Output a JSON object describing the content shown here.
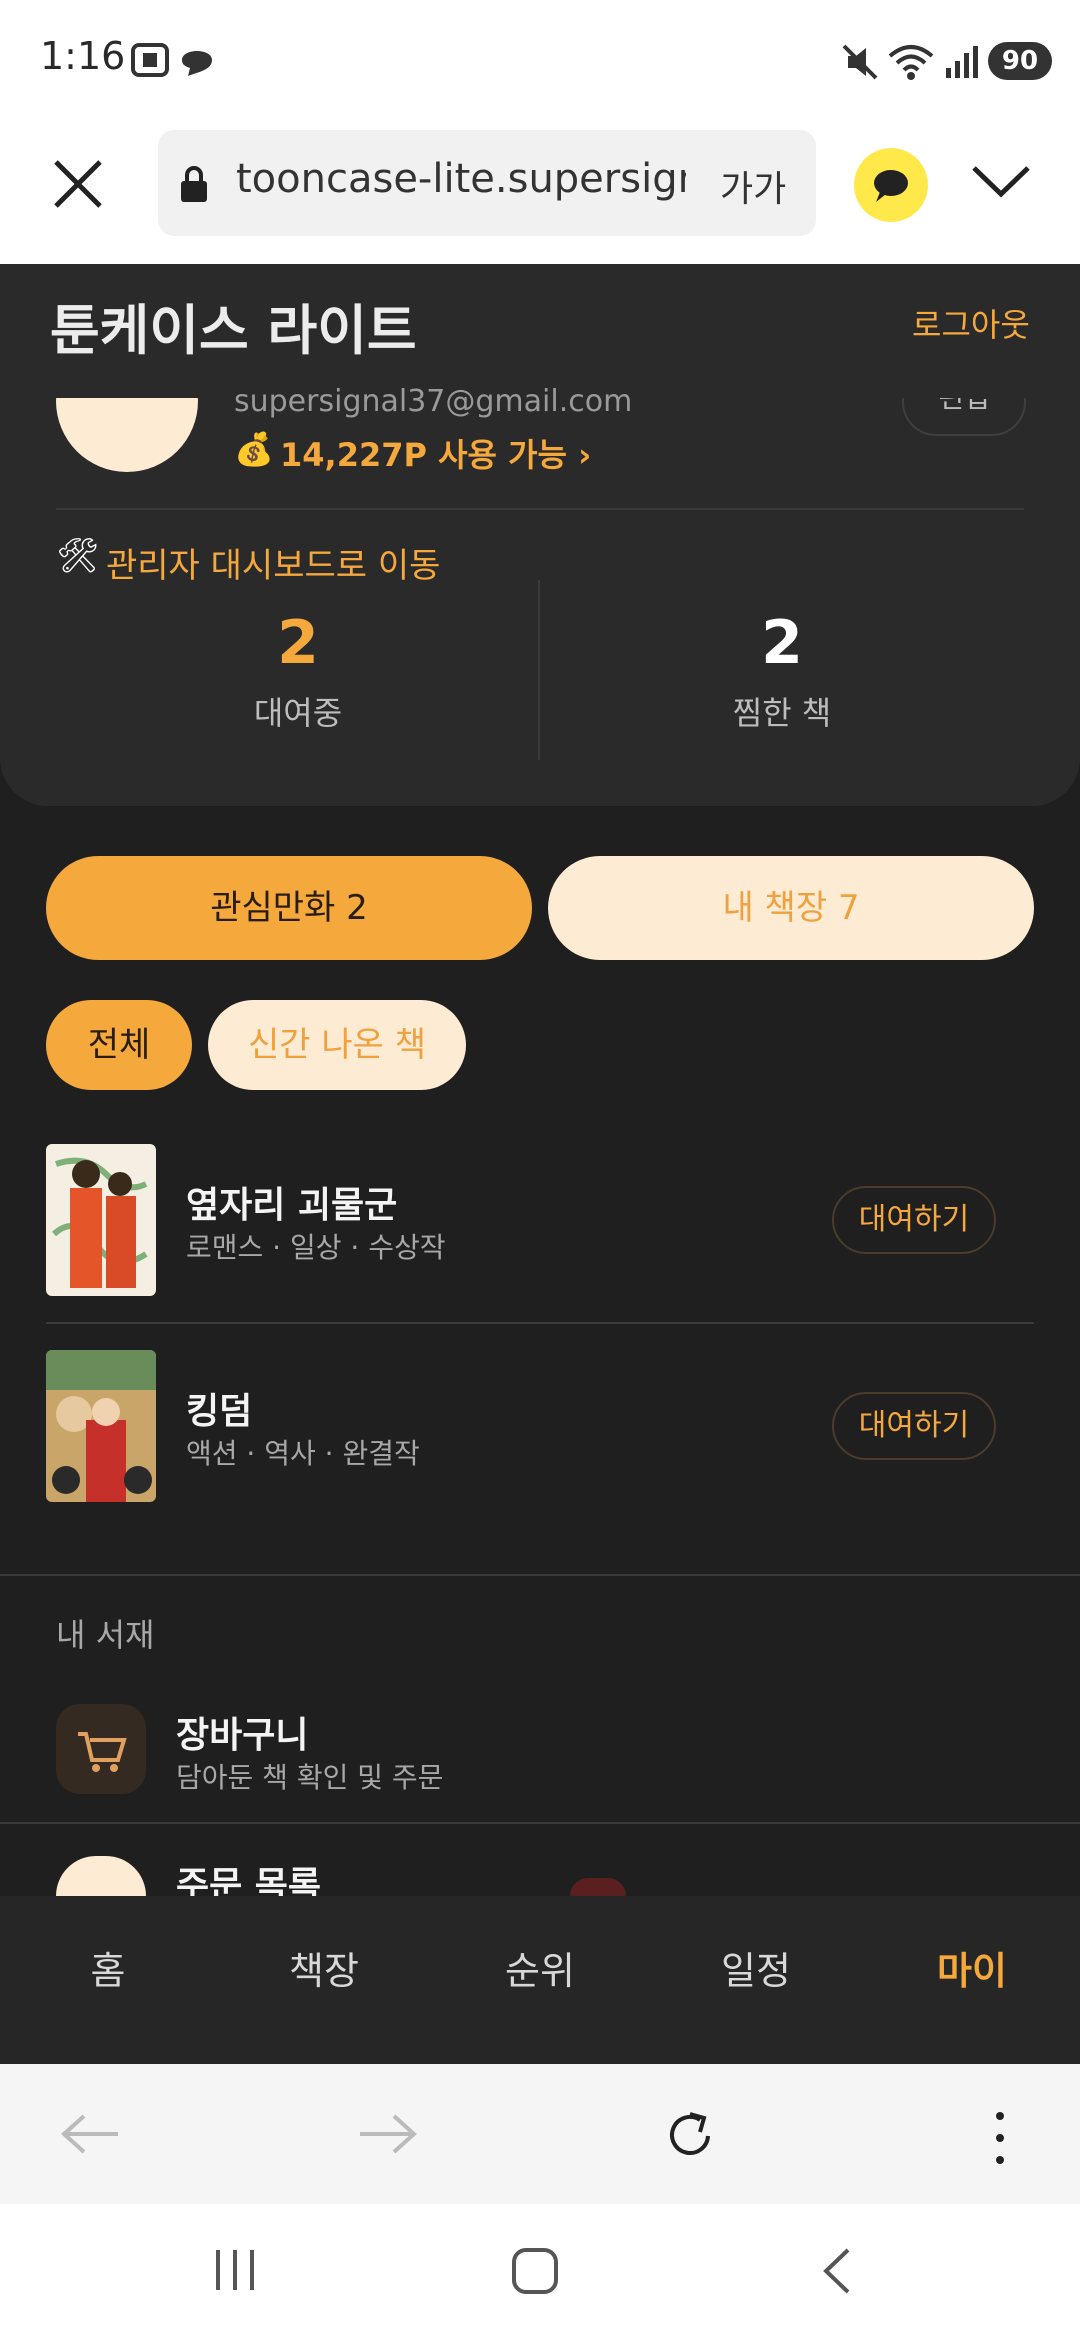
{
  "status": {
    "time": "1:16",
    "battery": "90"
  },
  "browser": {
    "url": "tooncase-lite.supersign",
    "reader_label": "가가"
  },
  "app": {
    "title": "툰케이스 라이트",
    "logout": "로그아웃"
  },
  "profile": {
    "email": "supersignal37@gmail.com",
    "points": "14,227P 사용 가능 ›",
    "edit_label": "편집",
    "admin_link": "관리자 대시보드로 이동"
  },
  "stats": [
    {
      "value": "2",
      "label": "대여중"
    },
    {
      "value": "2",
      "label": "찜한 책"
    }
  ],
  "tabs": [
    {
      "label": "관심만화 2",
      "active": true
    },
    {
      "label": "내 책장 7",
      "active": false
    }
  ],
  "filters": [
    {
      "label": "전체",
      "active": true
    },
    {
      "label": "신간 나온 책",
      "active": false
    }
  ],
  "books": [
    {
      "title": "옆자리 괴물군",
      "meta": "로맨스 · 일상 · 수상작",
      "action": "대여하기"
    },
    {
      "title": "킹덤",
      "meta": "액션 · 역사 · 완결작",
      "action": "대여하기"
    }
  ],
  "library": {
    "label": "내 서재",
    "items": [
      {
        "title": "장바구니",
        "subtitle": "담아둔 책 확인 및 주문"
      },
      {
        "title": "주문 목록",
        "subtitle": ""
      }
    ]
  },
  "nav": [
    {
      "label": "홈"
    },
    {
      "label": "책장"
    },
    {
      "label": "순위"
    },
    {
      "label": "일정"
    },
    {
      "label": "마이"
    }
  ],
  "colors": {
    "accent": "#f5a83c",
    "accent_light": "#fdebd3",
    "background": "#1f1f1f"
  }
}
